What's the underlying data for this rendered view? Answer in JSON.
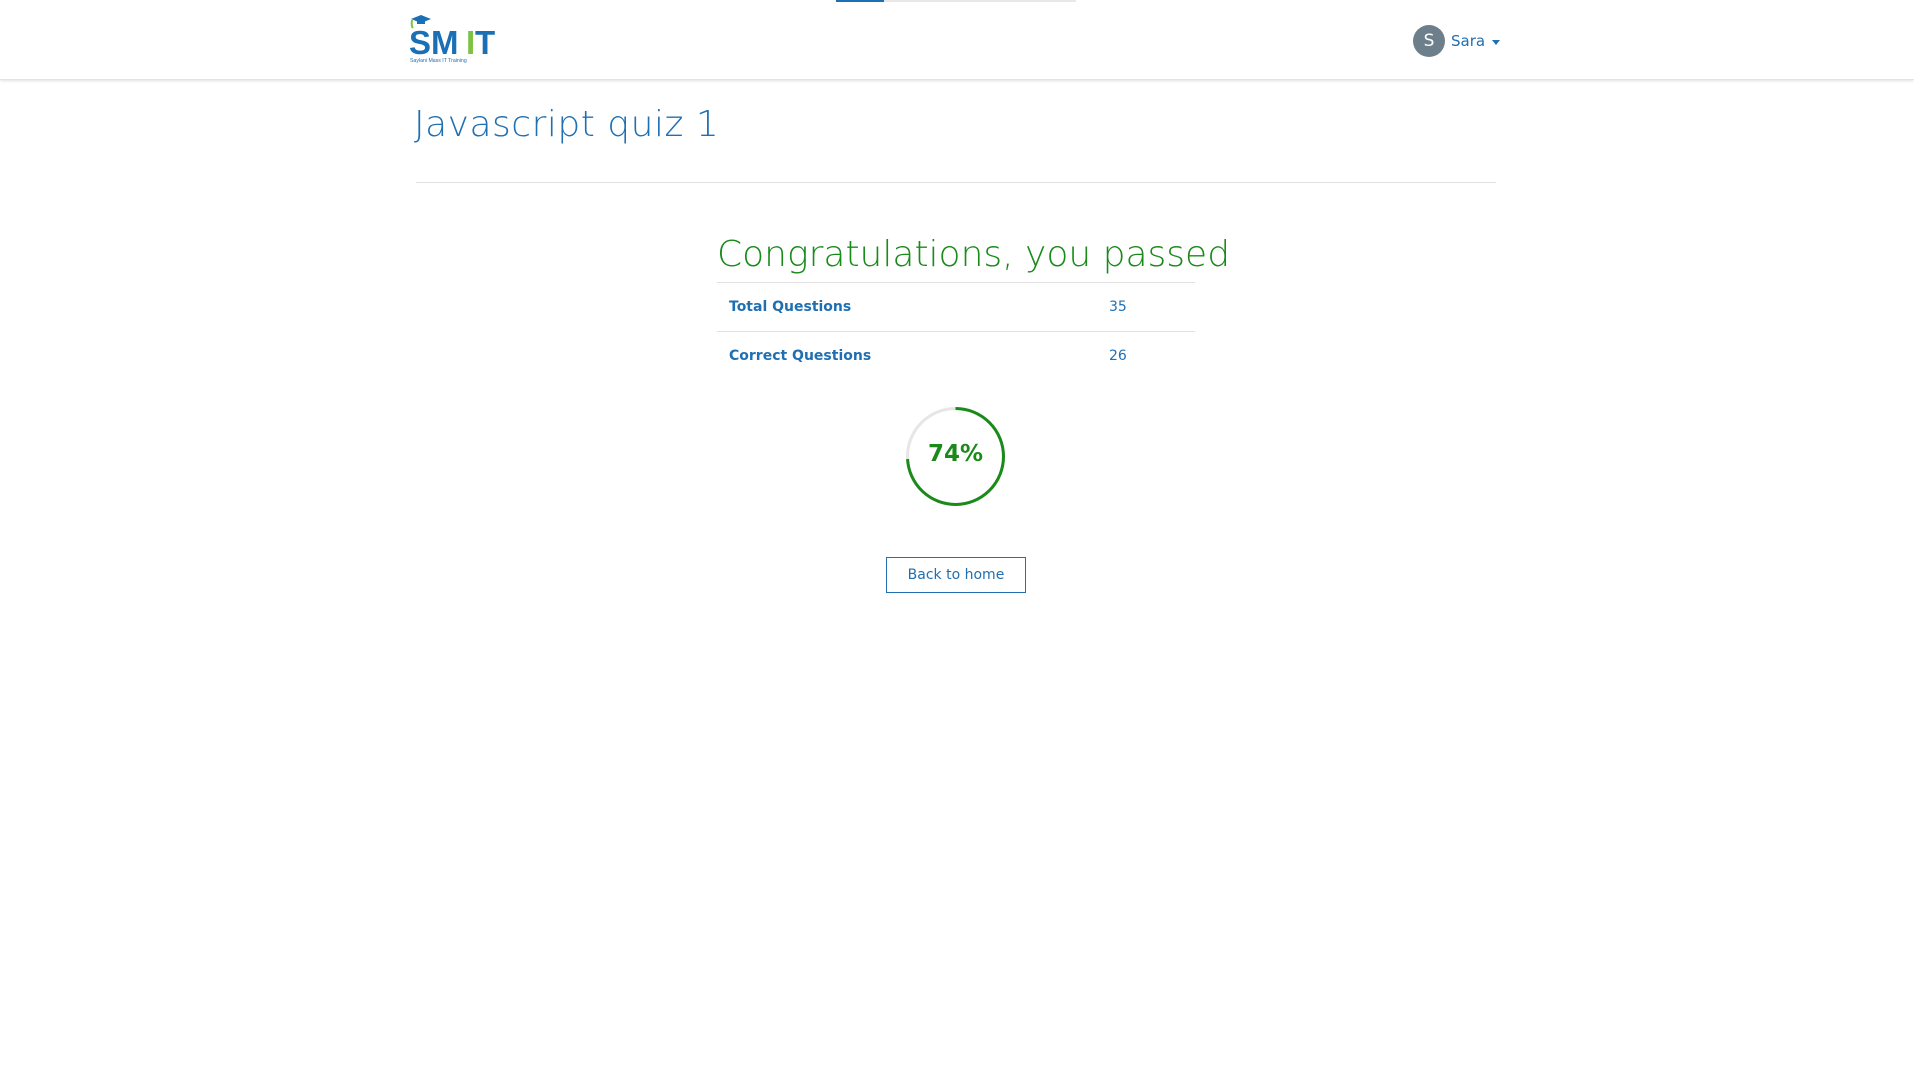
{
  "header": {
    "logo": {
      "text": "SMIT",
      "tagline": "Saylani Mass IT Training",
      "colors": {
        "primary": "#1a6fb5",
        "accent": "#7dc242"
      }
    },
    "loading_progress": 0.2,
    "user": {
      "initial": "S",
      "name": "Sara",
      "menu_icon": "caret-down-icon"
    }
  },
  "quiz": {
    "title": "Javascript quiz 1"
  },
  "result": {
    "heading": "Congratulations, you passed",
    "rows": [
      {
        "label": "Total Questions",
        "value": "35"
      },
      {
        "label": "Correct Questions",
        "value": "26"
      }
    ],
    "score_percent": 74,
    "score_text": "74%",
    "back_button_label": "Back to home"
  },
  "colors": {
    "primary": "#1f6fb2",
    "success": "#1a8a1a",
    "avatar": "#6e7f8c",
    "track": "#e6e6e6"
  }
}
